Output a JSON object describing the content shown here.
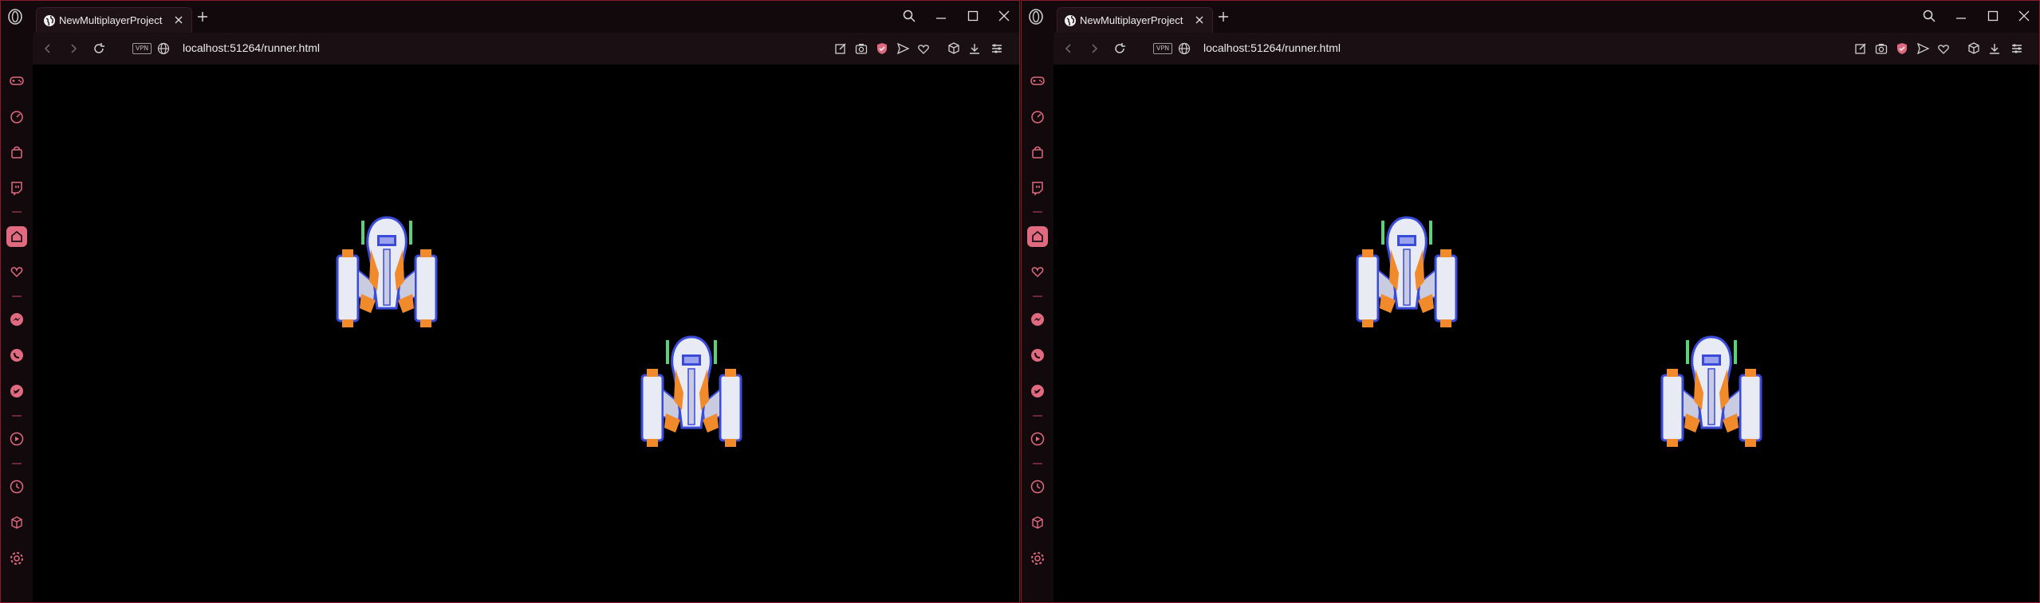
{
  "windows": [
    {
      "tab": {
        "title": "NewMultiplayerProject",
        "favicon": "globe-icon"
      },
      "address": {
        "url": "localhost:51264/runner.html",
        "vpn_badge": "VPN"
      }
    },
    {
      "tab": {
        "title": "NewMultiplayerProject",
        "favicon": "globe-icon"
      },
      "address": {
        "url": "localhost:51264/runner.html",
        "vpn_badge": "VPN"
      }
    }
  ],
  "sidebar_icons": [
    "gamepad-icon",
    "speedometer-icon",
    "shopping-bag-icon",
    "twitch-icon",
    "home-icon",
    "heart-icon",
    "messenger-icon",
    "whatsapp-icon",
    "twitter-icon",
    "player-icon",
    "history-icon",
    "extensions-cube-icon",
    "settings-gear-icon"
  ],
  "colors": {
    "accent": "#e06a80",
    "frame_border": "#8a1a2e",
    "chrome_bg": "#12090c",
    "addressbar_bg": "#1a0f13",
    "canvas_bg": "#000000",
    "ship_orange": "#f08a2a",
    "ship_blue": "#3a4bd8",
    "ship_white": "#e8eaf4"
  }
}
